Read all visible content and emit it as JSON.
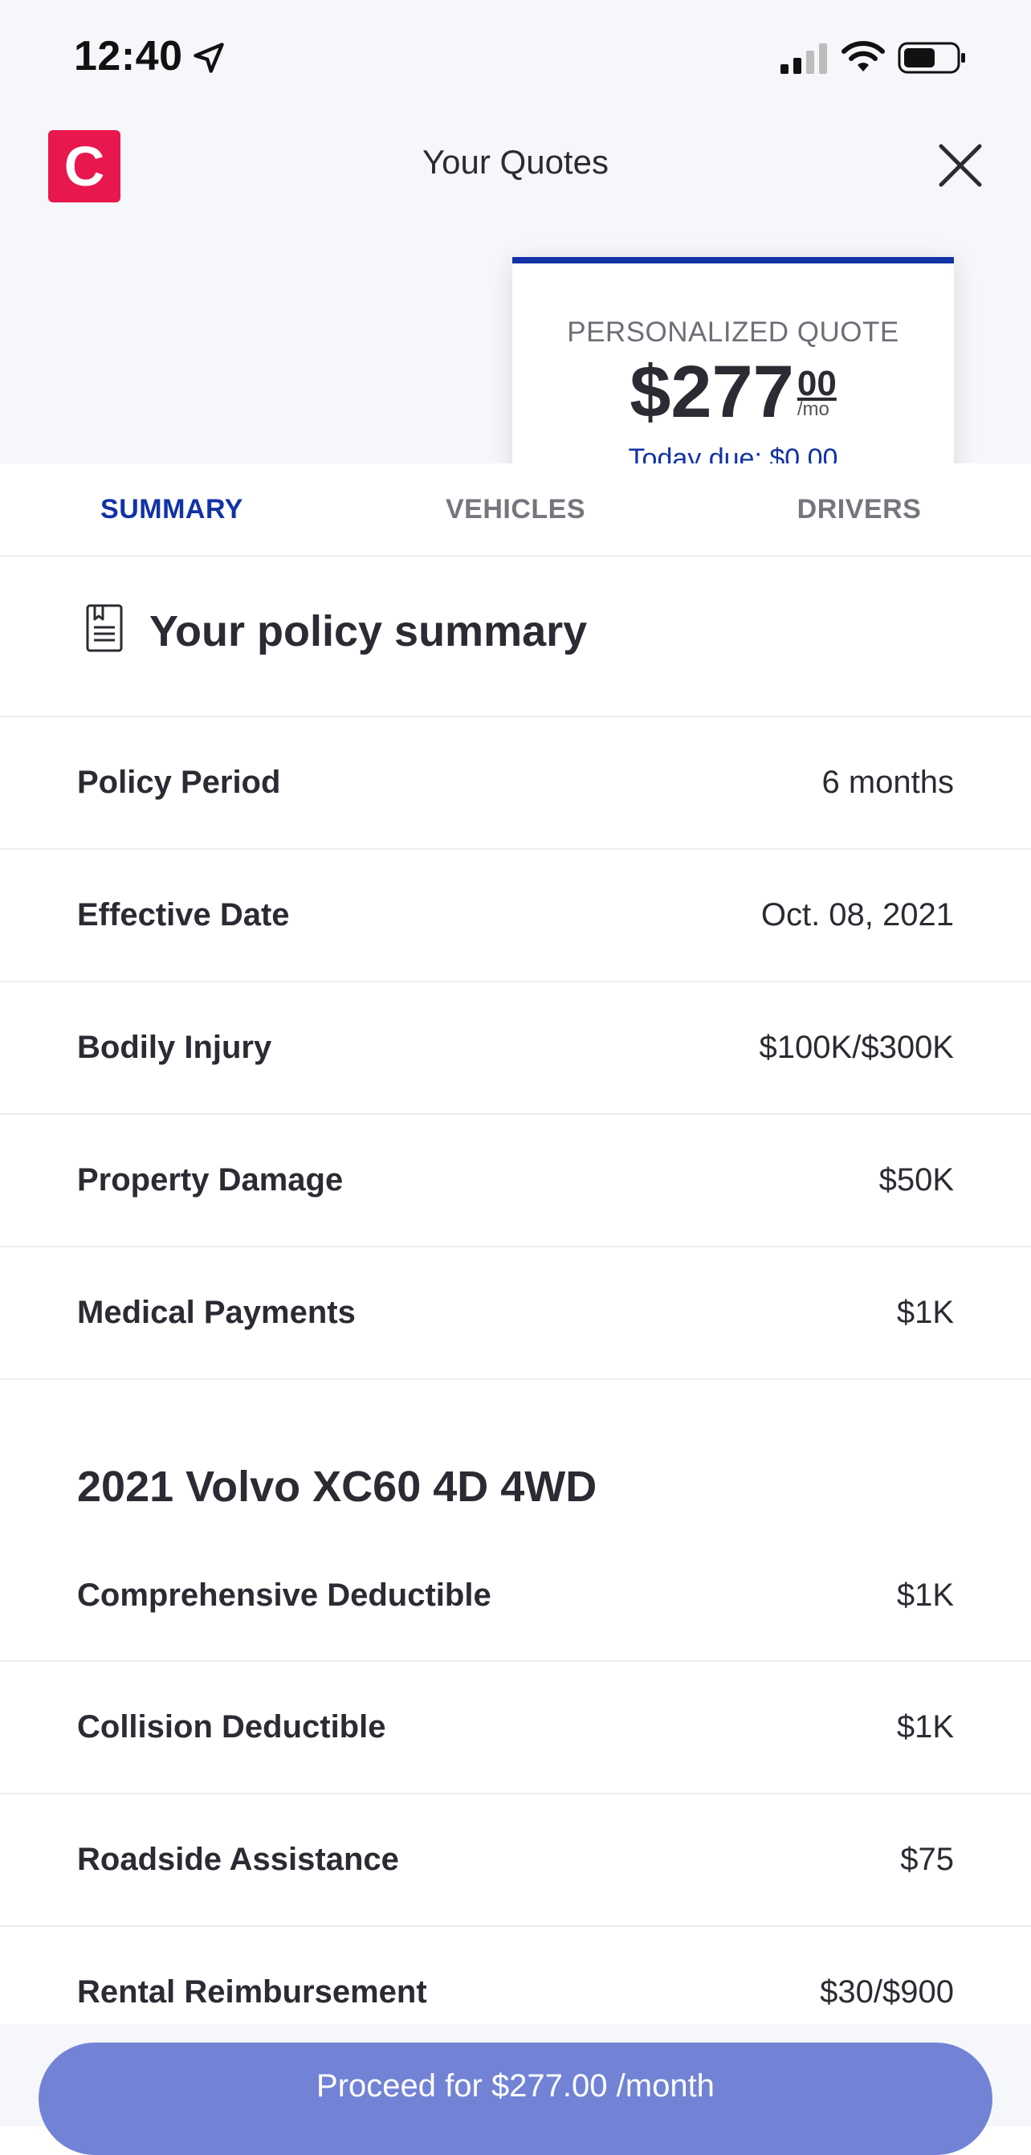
{
  "status_bar": {
    "time": "12:40",
    "icons": [
      "location-arrow-icon",
      "signal-icon",
      "wifi-icon",
      "battery-icon"
    ]
  },
  "header": {
    "logo_letter": "C",
    "logo_color": "#e8174e",
    "title": "Your Quotes"
  },
  "quote_card": {
    "label": "PERSONALIZED QUOTE",
    "price_main": "$277",
    "price_cents": "00",
    "price_unit": "/mo",
    "sub_text": "Today due: $0.00",
    "accent_color": "#1232a6"
  },
  "tabs": [
    {
      "label": "SUMMARY",
      "active": true
    },
    {
      "label": "VEHICLES",
      "active": false
    },
    {
      "label": "DRIVERS",
      "active": false
    }
  ],
  "summary": {
    "title": "Your policy summary",
    "rows": [
      {
        "label": "Policy Period",
        "value": "6 months"
      },
      {
        "label": "Effective Date",
        "value": "Oct. 08, 2021"
      },
      {
        "label": "Bodily Injury",
        "value": "$100K/$300K"
      },
      {
        "label": "Property Damage",
        "value": "$50K"
      },
      {
        "label": "Medical Payments",
        "value": "$1K"
      }
    ]
  },
  "vehicle": {
    "title": "2021 Volvo XC60 4D 4WD",
    "rows": [
      {
        "label": "Comprehensive Deductible",
        "value": "$1K"
      },
      {
        "label": "Collision Deductible",
        "value": "$1K"
      },
      {
        "label": "Roadside Assistance",
        "value": "$75"
      },
      {
        "label": "Rental Reimbursement",
        "value": "$30/$900"
      }
    ]
  },
  "proceed_button": {
    "label": "Proceed for $277.00 /month",
    "color": "#7283d6"
  }
}
